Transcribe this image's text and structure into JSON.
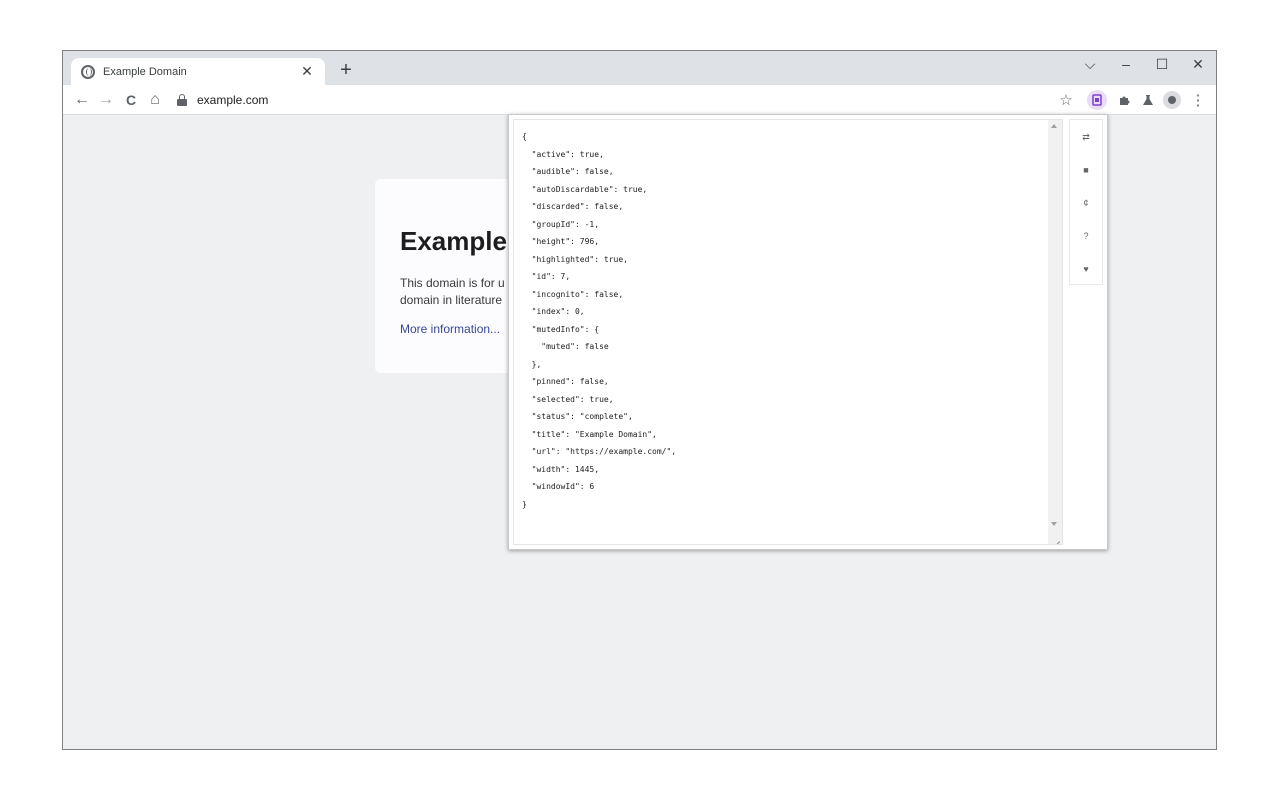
{
  "browser": {
    "tab": {
      "title": "Example Domain",
      "close_label": "✕",
      "favicon": "globe-icon"
    },
    "new_tab_label": "+",
    "window_controls": {
      "dropdown": "⌵",
      "minimize": "–",
      "maximize": "☐",
      "close": "✕"
    },
    "nav": {
      "back": "←",
      "forward": "→",
      "reload": "C",
      "home": "⌂"
    },
    "url": "example.com",
    "toolbar_icons": {
      "bookmark": "☆",
      "menu": "⋮"
    }
  },
  "page": {
    "heading": "Example",
    "desc_line1": "This domain is for u",
    "desc_line2": "domain in literature",
    "link": "More information..."
  },
  "popup": {
    "json_text": "{\n  \"active\": true,\n  \"audible\": false,\n  \"autoDiscardable\": true,\n  \"discarded\": false,\n  \"groupId\": -1,\n  \"height\": 796,\n  \"highlighted\": true,\n  \"id\": 7,\n  \"incognito\": false,\n  \"index\": 0,\n  \"mutedInfo\": {\n    \"muted\": false\n  },\n  \"pinned\": false,\n  \"selected\": true,\n  \"status\": \"complete\",\n  \"title\": \"Example Domain\",\n  \"url\": \"https://example.com/\",\n  \"width\": 1445,\n  \"windowId\": 6\n}",
    "side_buttons": [
      "⇄",
      "■",
      "¢",
      "?",
      "♥"
    ]
  },
  "colors": {
    "page_bg": "#eff0f2",
    "tabstrip_bg": "#dee1e6",
    "accent_extension": "#7b3fd1"
  }
}
